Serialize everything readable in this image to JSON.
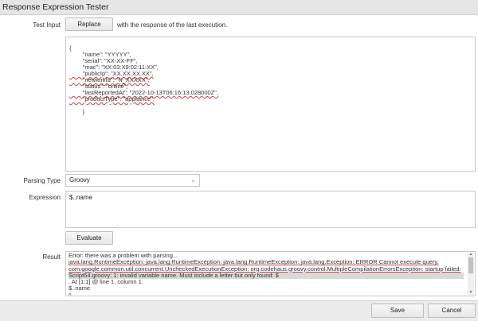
{
  "window": {
    "title": "Response Expression Tester"
  },
  "test_input": {
    "label": "Test Input",
    "replace_button": "Replace",
    "replace_hint": "with the response of the last execution.",
    "json_lines": [
      "{",
      "        \"name\": \"YYYYY\",",
      "        \"serial\": \"XX-XX-FF\",",
      "        \"mac\": \"XX:03:X9:02:11:XX\",",
      "        \"publicIp\": \"XX.XX.XX.XX\",",
      "        \"networkId\": \"N_XXXXX\",",
      "        \"status\": \"online\",",
      "        \"lastReportedAt\": \"2022-10-13T06:16:13.028000Z\",",
      "        \"productType\": \"appliance\",",
      "",
      "        }"
    ]
  },
  "parsing_type": {
    "label": "Parsing Type",
    "selected": "Groovy",
    "chevron_icon": "chevron-down-icon"
  },
  "expression": {
    "label": "Expression",
    "value": "$..name"
  },
  "evaluate_button": "Evaluate",
  "result": {
    "label": "Result",
    "lines": [
      "Error: there was a problem with parsing...",
      " java.lang.RuntimeException: java.lang.RuntimeException: java.lang.RuntimeException:  java.lang.Exception: ERROR Cannot execute query.",
      "com.google.common.util.concurrent.UncheckedExecutionException: org.codehaus.groovy.control.MultipleCompilationErrorsException: startup failed:",
      "Script54.groovy: 1: invalid variable name. Must include a letter but only found: $",
      ". At [1:1]  @ line 1, column 1.",
      "   $..name",
      "   ^"
    ]
  },
  "footer": {
    "save_button": "Save",
    "cancel_button": "Cancel"
  }
}
